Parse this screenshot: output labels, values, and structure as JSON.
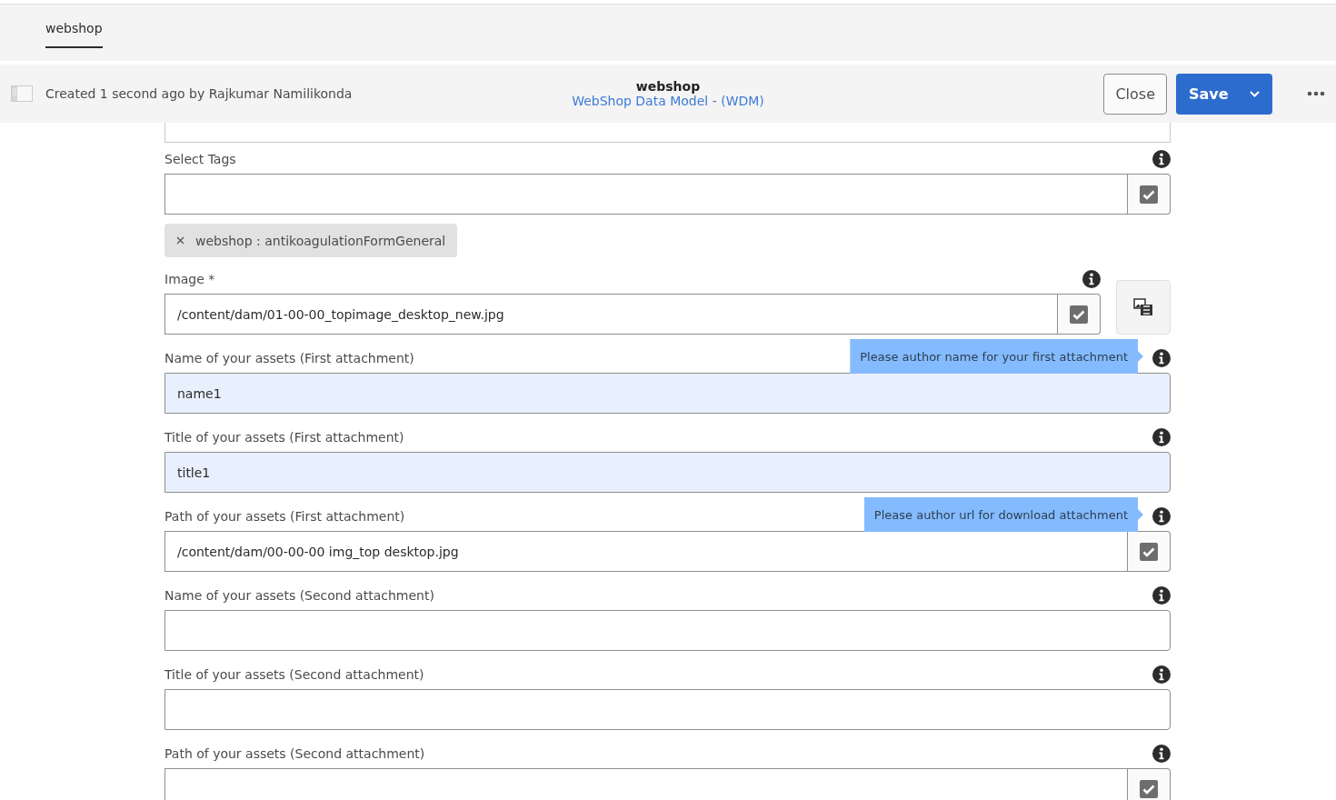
{
  "tabs": [
    {
      "label": "webshop",
      "selected": true
    }
  ],
  "header": {
    "created": "Created 1 second ago by Rajkumar Namilikonda",
    "title": "webshop",
    "subtitle": "WebShop Data Model - (WDM)",
    "close": "Close",
    "save": "Save"
  },
  "fields": [
    {
      "kind": "picker",
      "label": "Select Tags",
      "highlighted": false,
      "tags": [
        "webshop : antikoagulationFormGeneral"
      ]
    },
    {
      "kind": "image",
      "label": "Image *",
      "value": "/content/dam/01-00-00_topimage_desktop_new.jpg",
      "highlighted": false
    },
    {
      "kind": "text",
      "label": "Name of your assets (First attachment)",
      "value": "name1",
      "highlighted": true,
      "tooltip": "Please author name for your first attachment"
    },
    {
      "kind": "text",
      "label": "Title of your assets (First attachment)",
      "value": "title1",
      "highlighted": true
    },
    {
      "kind": "picker",
      "label": "Path of your assets (First attachment)",
      "value": "/content/dam/00-00-00 img_top desktop.jpg",
      "highlighted": false,
      "tooltip": "Please author url for download attachment"
    },
    {
      "kind": "text",
      "label": "Name of your assets (Second attachment)",
      "highlighted": false
    },
    {
      "kind": "text",
      "label": "Title of your assets (Second attachment)",
      "highlighted": false
    },
    {
      "kind": "picker",
      "label": "Path of your assets (Second attachment)",
      "highlighted": false
    }
  ]
}
